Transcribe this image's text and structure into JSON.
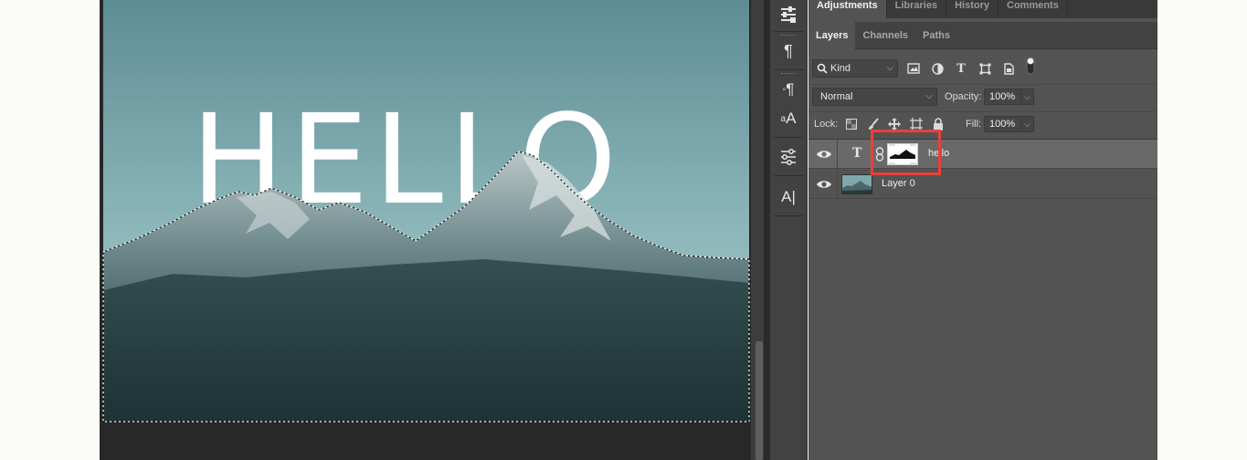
{
  "canvas": {
    "text": "HELLO"
  },
  "toolstrip": {
    "tools": [
      {
        "name": "properties-sliders-icon",
        "glyph": "⚟"
      },
      {
        "name": "paragraph-icon",
        "glyph": "¶"
      },
      {
        "name": "paragraph-styles-icon",
        "glyph": "¶"
      },
      {
        "name": "character-styles-icon",
        "glyph": "A"
      },
      {
        "name": "adjustments-sliders-icon",
        "glyph": "☰"
      },
      {
        "name": "character-icon",
        "glyph": "A|"
      }
    ]
  },
  "panel": {
    "top_tabs": [
      "Adjustments",
      "Libraries",
      "History",
      "Comments"
    ],
    "layer_tabs": [
      "Layers",
      "Channels",
      "Paths"
    ],
    "filter": {
      "kind_label": "Kind"
    },
    "blend": {
      "mode": "Normal",
      "opacity_label": "Opacity:",
      "opacity_value": "100%"
    },
    "lock": {
      "label": "Lock:",
      "fill_label": "Fill:",
      "fill_value": "100%"
    },
    "layers": [
      {
        "name": "hello",
        "type": "text",
        "selected": true
      },
      {
        "name": "Layer 0",
        "type": "image",
        "selected": false
      }
    ]
  },
  "colors": {
    "highlight": "#e8403b",
    "panel_bg": "#535353",
    "sky_top": "#5f8f96",
    "sky_bottom": "#9cc2c4"
  }
}
